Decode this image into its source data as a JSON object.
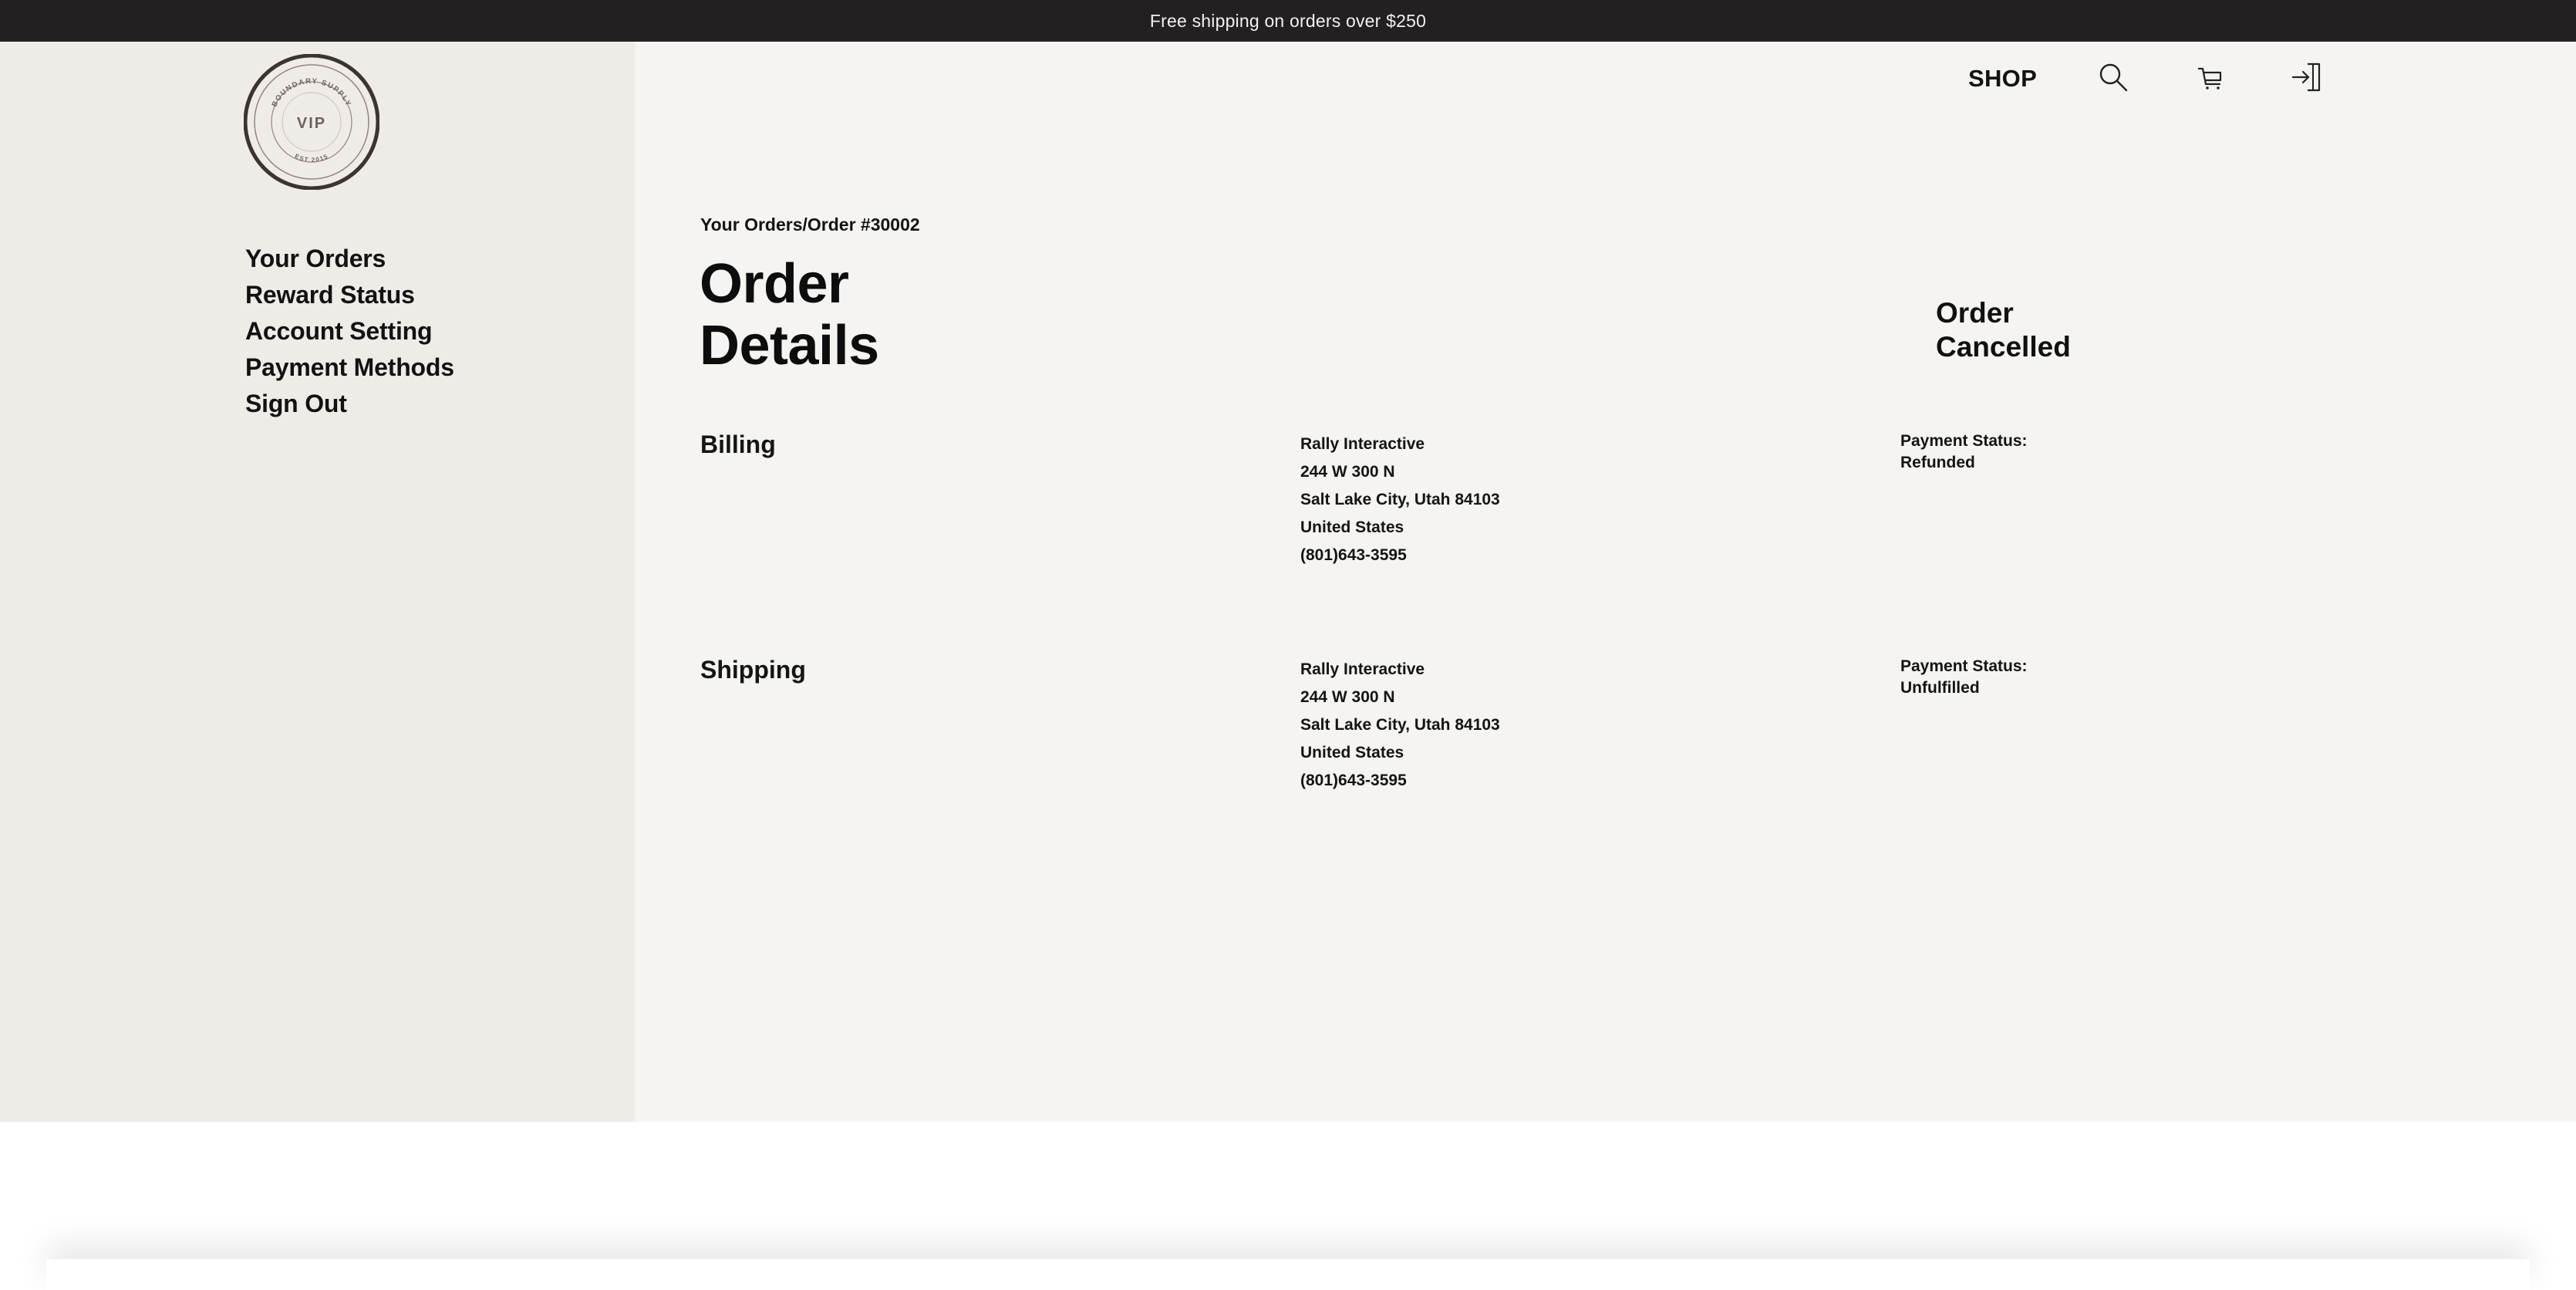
{
  "announcement": "Free shipping on orders over $250",
  "logo": {
    "center_text": "VIP",
    "ring_top": "BOUNDARY SUPPLY",
    "ring_bottom": "EST 2015"
  },
  "sidebar": {
    "items": [
      {
        "label": "Your Orders"
      },
      {
        "label": "Reward Status"
      },
      {
        "label": "Account Setting"
      },
      {
        "label": "Payment Methods"
      },
      {
        "label": "Sign Out"
      }
    ]
  },
  "header": {
    "shop_label": "SHOP",
    "icons": [
      "search-icon",
      "cart-icon",
      "sign-in-icon"
    ]
  },
  "breadcrumb": "Your Orders/Order #30002",
  "page_title": "Order Details",
  "order_status": "Order Cancelled",
  "billing": {
    "title": "Billing",
    "name": "Rally Interactive",
    "street": "244 W 300 N",
    "city": "Salt Lake City, Utah 84103",
    "country": "United States",
    "phone": "(801)643-3595",
    "status_label": "Payment Status:",
    "status_value": "Refunded"
  },
  "shipping": {
    "title": "Shipping",
    "name": "Rally Interactive",
    "street": "244 W 300 N",
    "city": "Salt Lake City, Utah 84103",
    "country": "United States",
    "phone": "(801)643-3595",
    "status_label": "Payment Status:",
    "status_value": "Unfulfilled"
  },
  "colors": {
    "announcement_bg": "#222020",
    "sidebar_bg": "#efece8",
    "main_bg": "#f5f4f1",
    "text": "#0d0d0d"
  }
}
